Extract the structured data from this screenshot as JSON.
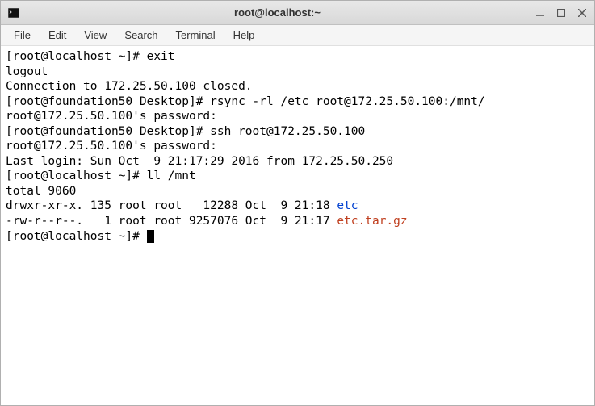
{
  "window": {
    "title": "root@localhost:~"
  },
  "menubar": {
    "file": "File",
    "edit": "Edit",
    "view": "View",
    "search": "Search",
    "terminal": "Terminal",
    "help": "Help"
  },
  "lines": {
    "l0": "[root@localhost ~]# exit",
    "l1": "logout",
    "l2": "Connection to 172.25.50.100 closed.",
    "l3": "[root@foundation50 Desktop]# rsync -rl /etc root@172.25.50.100:/mnt/",
    "l4": "root@172.25.50.100's password: ",
    "l5": "[root@foundation50 Desktop]# ssh root@172.25.50.100",
    "l6": "root@172.25.50.100's password: ",
    "l7": "Last login: Sun Oct  9 21:17:29 2016 from 172.25.50.250",
    "l8": "[root@localhost ~]# ll /mnt",
    "l9": "total 9060",
    "l10a": "drwxr-xr-x. 135 root root   12288 Oct  9 21:18 ",
    "l10b": "etc",
    "l11a": "-rw-r--r--.   1 root root 9257076 Oct  9 21:17 ",
    "l11b": "etc.tar.gz",
    "l12": "[root@localhost ~]# "
  }
}
